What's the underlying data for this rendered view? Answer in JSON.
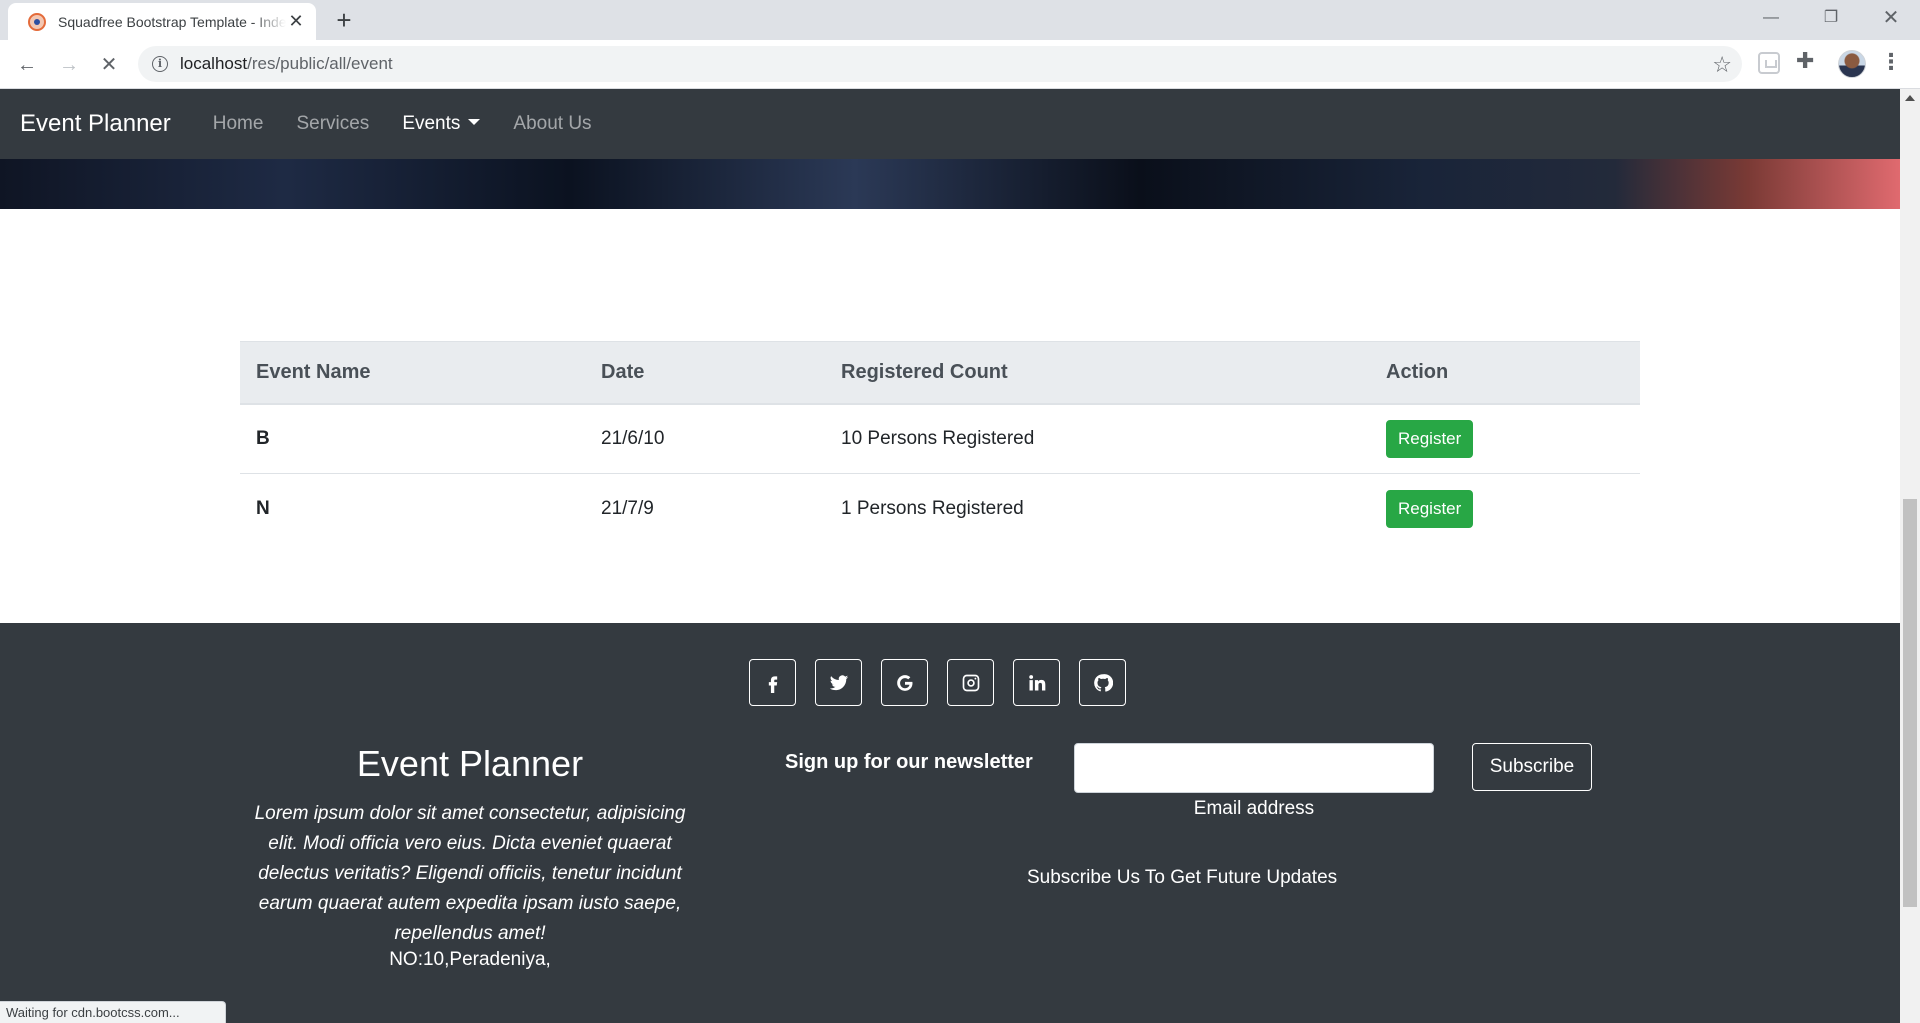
{
  "browser": {
    "tab_title": "Squadfree Bootstrap Template - Index",
    "url_host": "localhost",
    "url_path": "/res/public/all/event",
    "status_text": "Waiting for cdn.bootcss.com..."
  },
  "navbar": {
    "brand": "Event Planner",
    "links": [
      "Home",
      "Services",
      "Events",
      "About Us"
    ],
    "active": "Events"
  },
  "events_table": {
    "headers": [
      "Event Name",
      "Date",
      "Registered Count",
      "Action"
    ],
    "rows": [
      {
        "name": "B",
        "date": "21/6/10",
        "count": "10 Persons Registered",
        "action": "Register"
      },
      {
        "name": "N",
        "date": "21/7/9",
        "count": "1 Persons Registered",
        "action": "Register"
      }
    ]
  },
  "footer": {
    "social_icons": [
      "facebook-icon",
      "twitter-icon",
      "google-icon",
      "instagram-icon",
      "linkedin-icon",
      "github-icon"
    ],
    "brand": "Event Planner",
    "description": "Lorem ipsum dolor sit amet consectetur, adipisicing elit. Modi officia vero eius. Dicta eveniet quaerat delectus veritatis? Eligendi officiis, tenetur incidunt earum quaerat autem expedita ipsam iusto saepe, repellendus amet!",
    "address": "NO:10,Peradeniya,",
    "newsletter_label": "Sign up for our newsletter",
    "email_value": "",
    "email_label": "Email address",
    "subscribe_label": "Subscribe",
    "tagline": "Subscribe Us To Get Future Updates"
  },
  "colors": {
    "navbar_bg": "#343a40",
    "register_button": "#28a745",
    "table_header_bg": "#e9ecef"
  }
}
